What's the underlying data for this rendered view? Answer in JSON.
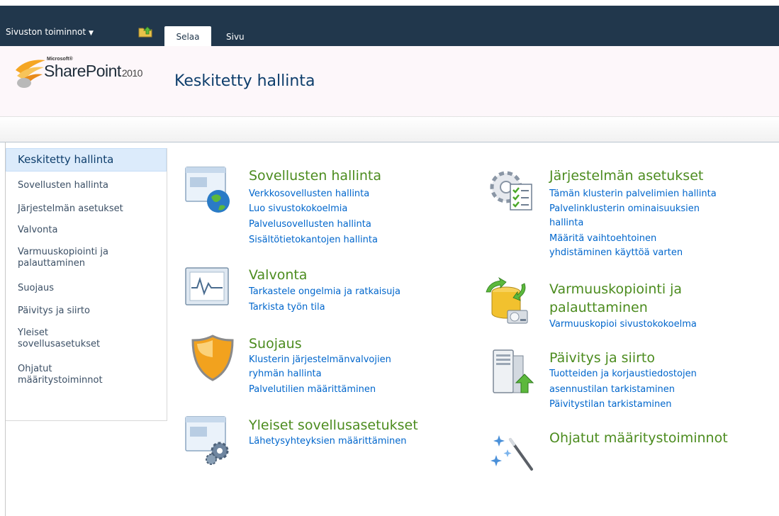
{
  "ribbon": {
    "site_actions": "Sivuston toiminnot",
    "tabs": [
      {
        "label": "Selaa"
      },
      {
        "label": "Sivu"
      }
    ]
  },
  "header": {
    "logo_microsoft": "Microsoft®",
    "logo_product": "SharePoint",
    "logo_version": "2010",
    "title": "Keskitetty hallinta"
  },
  "leftnav": {
    "items": [
      {
        "label": "Keskitetty hallinta"
      },
      {
        "label": "Sovellusten hallinta"
      },
      {
        "label": "Järjestelmän asetukset"
      },
      {
        "label": "Valvonta"
      },
      {
        "label": "Varmuuskopiointi ja palauttaminen"
      },
      {
        "label": "Suojaus"
      },
      {
        "label": "Päivitys ja siirto"
      },
      {
        "label": "Yleiset sovellusasetukset"
      },
      {
        "label": "Ohjatut määritystoiminnot"
      }
    ]
  },
  "sections": {
    "apps": {
      "title": "Sovellusten hallinta",
      "icon": "application-globe-icon",
      "links": [
        "Verkkosovellusten hallinta",
        "Luo sivustokokoelmia",
        "Palvelusovellusten hallinta",
        "Sisältötietokantojen hallinta"
      ]
    },
    "monitoring": {
      "title": "Valvonta",
      "icon": "monitor-graph-icon",
      "links": [
        "Tarkastele ongelmia ja ratkaisuja",
        "Tarkista työn tila"
      ]
    },
    "security": {
      "title": "Suojaus",
      "icon": "shield-icon",
      "links": [
        "Klusterin järjestelmänvalvojien",
        "ryhmän hallinta",
        "Palvelutilien määrittäminen"
      ]
    },
    "general": {
      "title": "Yleiset sovellusasetukset",
      "icon": "application-gears-icon",
      "links": [
        "Lähetysyhteyksien määrittäminen"
      ]
    },
    "system": {
      "title": "Järjestelmän asetukset",
      "icon": "gear-checklist-icon",
      "links": [
        "Tämän klusterin palvelimien hallinta",
        "Palvelinklusterin ominaisuuksien",
        "hallinta",
        "Määritä vaihtoehtoinen",
        "yhdistäminen käyttöä varten"
      ]
    },
    "backup": {
      "title_line1": "Varmuuskopiointi ja",
      "title_line2": "palauttaminen",
      "icon": "database-backup-icon",
      "links": [
        "Varmuuskopioi sivustokokoelma"
      ]
    },
    "upgrade": {
      "title": "Päivitys ja siirto",
      "icon": "server-upgrade-icon",
      "links": [
        "Tuotteiden ja korjaustiedostojen",
        "asennustilan tarkistaminen",
        "Päivitystilan tarkistaminen"
      ]
    },
    "wizards": {
      "title": "Ohjatut määritystoiminnot",
      "icon": "magic-wand-icon",
      "links": []
    }
  },
  "colors": {
    "ribbon_bg": "#21374c",
    "section_title": "#4c8c1f",
    "link": "#0066cc",
    "page_title": "#0e3e6c"
  }
}
